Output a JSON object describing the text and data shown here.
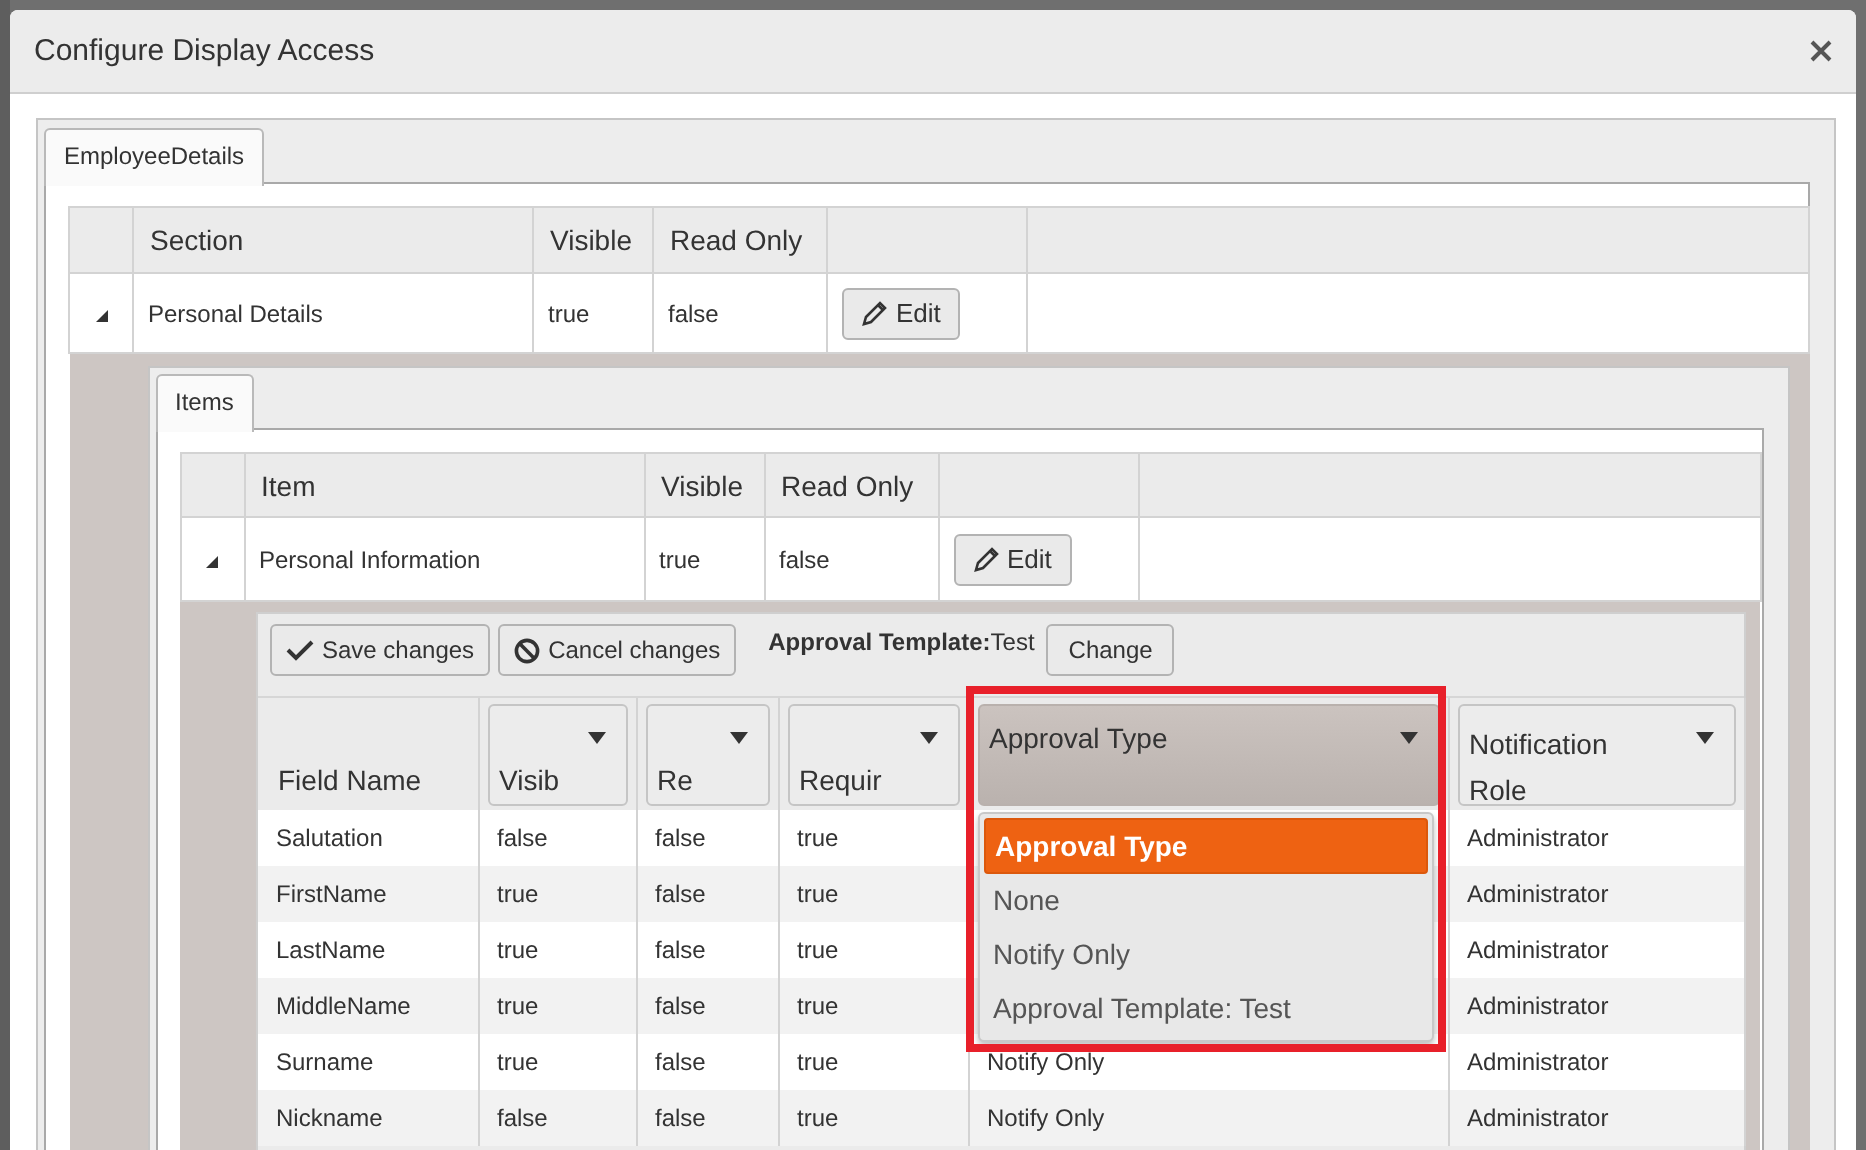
{
  "dialog": {
    "title": "Configure Display Access"
  },
  "tabs": [
    {
      "label": "EmployeeDetails",
      "selected": true
    }
  ],
  "sections_table": {
    "columns": [
      "Section",
      "Visible",
      "Read Only"
    ],
    "rows": [
      {
        "expanded": true,
        "cells": [
          "Personal Details",
          "true",
          "false"
        ],
        "action": "Edit"
      }
    ]
  },
  "item_tabs": [
    {
      "label": "Items",
      "selected": true
    }
  ],
  "items_table": {
    "columns": [
      "Item",
      "Visible",
      "Read Only"
    ],
    "rows": [
      {
        "expanded": true,
        "cells": [
          "Personal Information",
          "true",
          "false"
        ],
        "action": "Edit"
      }
    ]
  },
  "fields_grid": {
    "toolbar": {
      "buttons": [
        {
          "kind": "save",
          "label": "Save changes"
        },
        {
          "kind": "cancel",
          "label": "Cancel changes"
        }
      ],
      "template_label": "Approval Template:",
      "template_value": "Test",
      "change_button": "Change"
    },
    "columns": [
      {
        "label": "Field Name",
        "filter": false,
        "active": false
      },
      {
        "label": "Visib",
        "filter": true,
        "active": false
      },
      {
        "label": "Re",
        "filter": true,
        "active": false
      },
      {
        "label": "Requir",
        "filter": true,
        "active": false
      },
      {
        "label": "Approval Type",
        "filter": true,
        "active": true
      },
      {
        "label": "Notification Role",
        "filter": true,
        "active": false
      }
    ],
    "rows": [
      {
        "cells": [
          "Salutation",
          "false",
          "false",
          "true",
          null,
          "Administrator"
        ]
      },
      {
        "cells": [
          "FirstName",
          "true",
          "false",
          "true",
          null,
          "Administrator"
        ]
      },
      {
        "cells": [
          "LastName",
          "true",
          "false",
          "true",
          null,
          "Administrator"
        ]
      },
      {
        "cells": [
          "MiddleName",
          "true",
          "false",
          "true",
          null,
          "Administrator"
        ]
      },
      {
        "cells": [
          "Surname",
          "true",
          "false",
          "true",
          "Notify Only",
          "Administrator"
        ]
      },
      {
        "cells": [
          "Nickname",
          "false",
          "false",
          "true",
          "Notify Only",
          "Administrator"
        ]
      }
    ],
    "dropdown": {
      "options": [
        {
          "label": "Approval Type",
          "selected": true
        },
        {
          "label": "None",
          "selected": false
        },
        {
          "label": "Notify Only",
          "selected": false
        },
        {
          "label": "Approval Template: Test",
          "selected": false
        }
      ]
    },
    "highlight_frame": true
  }
}
